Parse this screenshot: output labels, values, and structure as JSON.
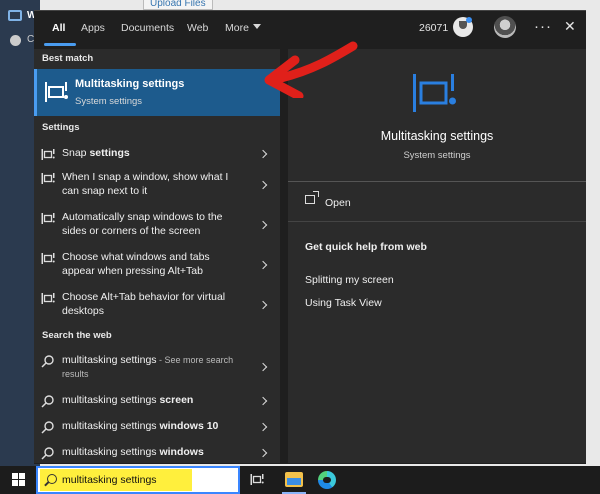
{
  "background": {
    "upload_label": "Upload Files",
    "title_initial": "W",
    "c_initial": "C"
  },
  "tabs": [
    {
      "label": "All"
    },
    {
      "label": "Apps"
    },
    {
      "label": "Documents"
    },
    {
      "label": "Web"
    },
    {
      "label": "More"
    }
  ],
  "header": {
    "points": "26071"
  },
  "best_match": {
    "heading": "Best match",
    "title": "Multitasking settings",
    "subtitle": "System settings"
  },
  "settings": {
    "heading": "Settings",
    "items": [
      {
        "text": "Snap ",
        "bold": "settings"
      },
      {
        "text": "When I snap a window, show what I can snap next to it",
        "bold": ""
      },
      {
        "text": "Automatically snap windows to the sides or corners of the screen",
        "bold": ""
      },
      {
        "text": "Choose what windows and tabs appear when pressing Alt+Tab",
        "bold": ""
      },
      {
        "text": "Choose Alt+Tab behavior for virtual desktops",
        "bold": ""
      }
    ]
  },
  "web": {
    "heading": "Search the web",
    "items": [
      {
        "text": "multitasking settings",
        "bold": "",
        "note": " - See more search results"
      },
      {
        "text": "multitasking settings ",
        "bold": "screen",
        "note": ""
      },
      {
        "text": "multitasking settings ",
        "bold": "windows 10",
        "note": ""
      },
      {
        "text": "multitasking settings ",
        "bold": "windows",
        "note": ""
      }
    ]
  },
  "preview": {
    "title": "Multitasking settings",
    "subtitle": "System settings",
    "open_label": "Open",
    "help_heading": "Get quick help from web",
    "help_links": [
      "Splitting my screen",
      "Using Task View"
    ]
  },
  "taskbar": {
    "search_value": "multitasking settings"
  },
  "colors": {
    "accent": "#4a9cf0",
    "selected_bg": "#1d5b8d",
    "annotation_red": "#e0201a",
    "highlight_yellow": "#ffef3d"
  }
}
